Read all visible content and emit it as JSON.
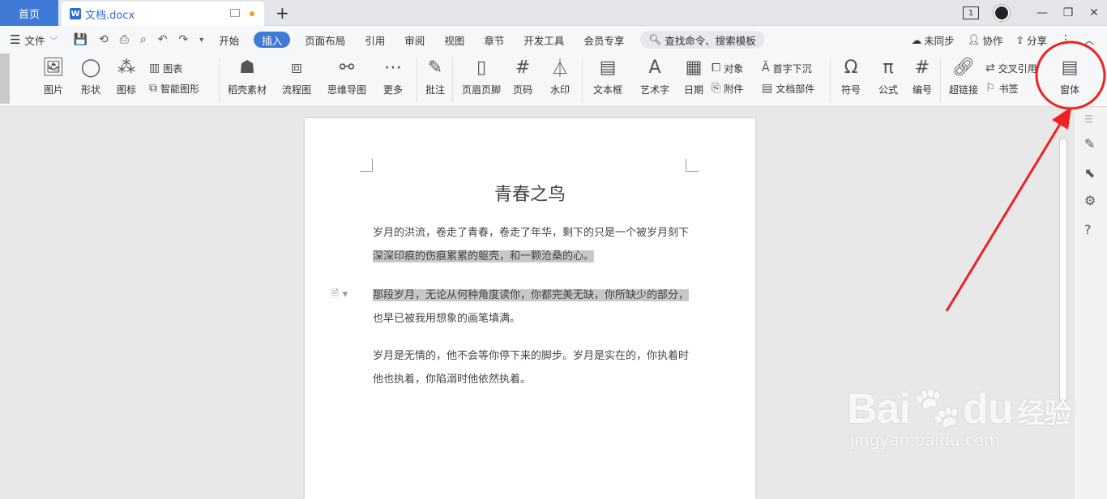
{
  "tabs": {
    "home": "首页",
    "doc_icon": "W",
    "doc_name": "文档.docx",
    "add": "+"
  },
  "window": {
    "page_count": "1",
    "minimize": "—",
    "restore": "❐",
    "close": "✕"
  },
  "menu": {
    "file": "文件",
    "items": [
      "开始",
      "插入",
      "页面布局",
      "引用",
      "审阅",
      "视图",
      "章节",
      "开发工具",
      "会员专享"
    ],
    "active": "插入",
    "search": "查找命令、搜索模板",
    "sync": "未同步",
    "collab": "协作",
    "share": "分享"
  },
  "ribbon": {
    "picture": "图片",
    "shape": "形状",
    "icon": "图标",
    "chart": "图表",
    "smart": "智能图形",
    "straw": "稻壳素材",
    "flow": "流程图",
    "mind": "思维导图",
    "more": "更多",
    "comment": "批注",
    "header": "页眉页脚",
    "pagenum": "页码",
    "watermark": "水印",
    "textbox": "文本框",
    "arttext": "艺术字",
    "date": "日期",
    "object": "对象",
    "attach": "附件",
    "dropcap": "首字下沉",
    "docpart": "文档部件",
    "symbol": "符号",
    "formula": "公式",
    "numbering": "编号",
    "hyperlink": "超链接",
    "crossref": "交叉引用",
    "bookmark": "书签",
    "form": "窗体"
  },
  "document": {
    "title": "青春之鸟",
    "p1_line1": "岁月的洪流，卷走了青春，卷走了年华，剩下的只是一个被岁月刻下",
    "p1_line2": "深深印痕的伤痕累累的躯壳，和一颗沧桑的心。",
    "p2_line1": "那段岁月，无论从何种角度读你，你都完美无缺，你所缺少的部分，",
    "p2_line2": "也早已被我用想象的画笔填满。",
    "p3_line1": "岁月是无情的，他不会等你停下来的脚步。岁月是实在的，你执着时",
    "p3_line2": "他也执着，你陷溺时他依然执着。"
  },
  "watermark": {
    "brand": "Bai",
    "brand2": "du",
    "cn": "经验",
    "url": "jingyan.baidu.com"
  },
  "colors": {
    "accent": "#3f7bd6",
    "annotation": "#ee2222",
    "highlight": "#c8c8c8"
  }
}
